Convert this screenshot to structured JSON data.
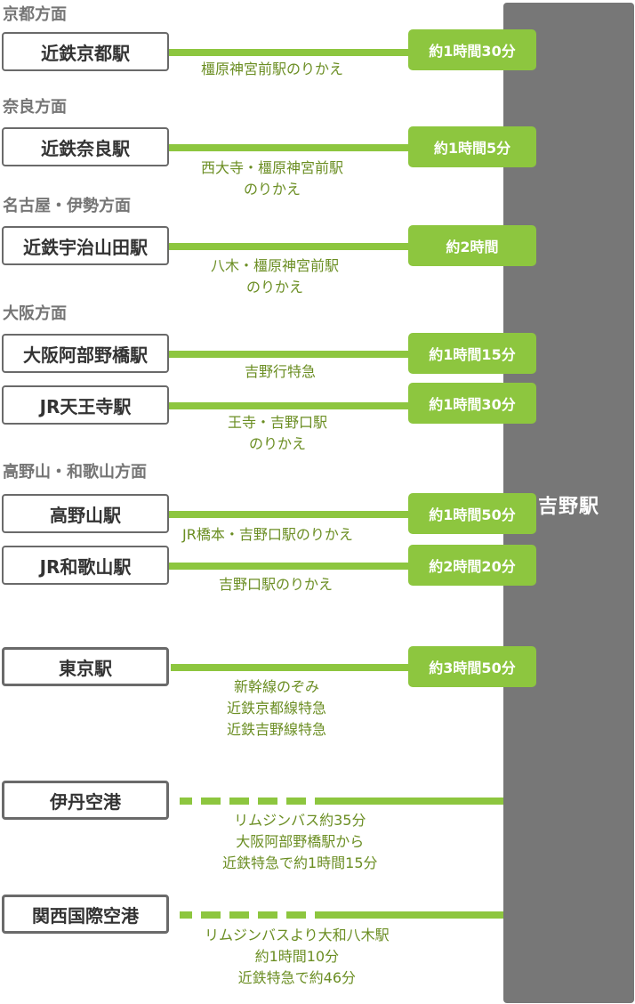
{
  "destination": "吉野駅",
  "colors": {
    "accent": "#8dc63f",
    "destination": "#777777",
    "note_text": "#6b8e23",
    "region_text": "#757575"
  },
  "groups": {
    "kyoto": {
      "region": "京都方面",
      "route": {
        "station": "近鉄京都駅",
        "time": "約1時間30分",
        "notes": [
          "橿原神宮前駅のりかえ"
        ]
      }
    },
    "nara": {
      "region": "奈良方面",
      "route": {
        "station": "近鉄奈良駅",
        "time": "約1時間5分",
        "notes": [
          "西大寺・橿原神宮前駅",
          "のりかえ"
        ]
      }
    },
    "nagoya": {
      "region": "名古屋・伊勢方面",
      "route": {
        "station": "近鉄宇治山田駅",
        "time": "約2時間",
        "notes": [
          "八木・橿原神宮前駅",
          "のりかえ"
        ]
      }
    },
    "osaka": {
      "region": "大阪方面",
      "routes": [
        {
          "station": "大阪阿部野橋駅",
          "time": "約1時間15分",
          "notes": [
            "吉野行特急"
          ]
        },
        {
          "station": "JR天王寺駅",
          "time": "約1時間30分",
          "notes": [
            "王寺・吉野口駅",
            "のりかえ"
          ]
        }
      ]
    },
    "koyasan": {
      "region": "高野山・和歌山方面",
      "routes": [
        {
          "station": "高野山駅",
          "time": "約1時間50分",
          "notes": [
            "JR橋本・吉野口駅のりかえ"
          ]
        },
        {
          "station": "JR和歌山駅",
          "time": "約2時間20分",
          "notes": [
            "吉野口駅のりかえ"
          ]
        }
      ]
    },
    "tokyo": {
      "route": {
        "station": "東京駅",
        "time": "約3時間50分",
        "notes": [
          "新幹線のぞみ",
          "近鉄京都線特急",
          "近鉄吉野線特急"
        ]
      }
    },
    "itami": {
      "route": {
        "station": "伊丹空港",
        "notes": [
          "リムジンバス約35分",
          "大阪阿部野橋駅から",
          "近鉄特急で約1時間15分"
        ]
      }
    },
    "kansai": {
      "route": {
        "station": "関西国際空港",
        "notes": [
          "リムジンバスより大和八木駅",
          "約1時間10分",
          "近鉄特急で約46分"
        ]
      }
    }
  }
}
